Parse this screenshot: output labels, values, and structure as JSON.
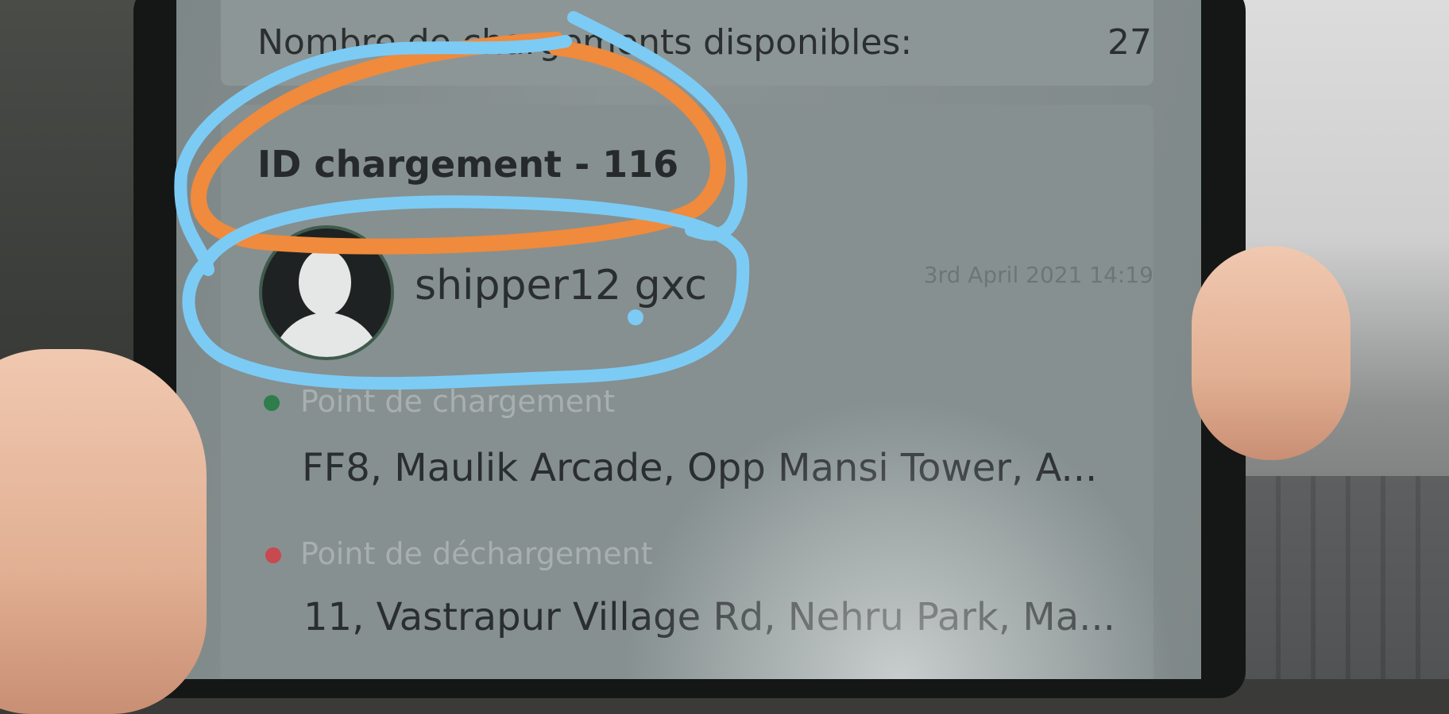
{
  "summary": {
    "available_label": "Nombre de chargements disponibles:",
    "available_count": "27"
  },
  "load": {
    "id_label": "ID chargement - 116",
    "shipper_name": "shipper12 gxc",
    "date": "3rd April 2021 14:19",
    "loading_point_label": "Point de chargement",
    "loading_address": "FF8, Maulik Arcade, Opp Mansi Tower, A...",
    "unloading_point_label": "Point de déchargement",
    "unloading_address": "11, Vastrapur Village Rd, Nehru Park, Ma..."
  },
  "colors": {
    "annotation_orange": "#f08a3c",
    "annotation_blue": "#7ccbf5",
    "loading_dot": "#2e7d4a",
    "unloading_dot": "#c8494f"
  },
  "icons": {
    "avatar": "user-silhouette-icon",
    "loading_marker": "green-dot-icon",
    "unloading_marker": "red-dot-icon"
  }
}
